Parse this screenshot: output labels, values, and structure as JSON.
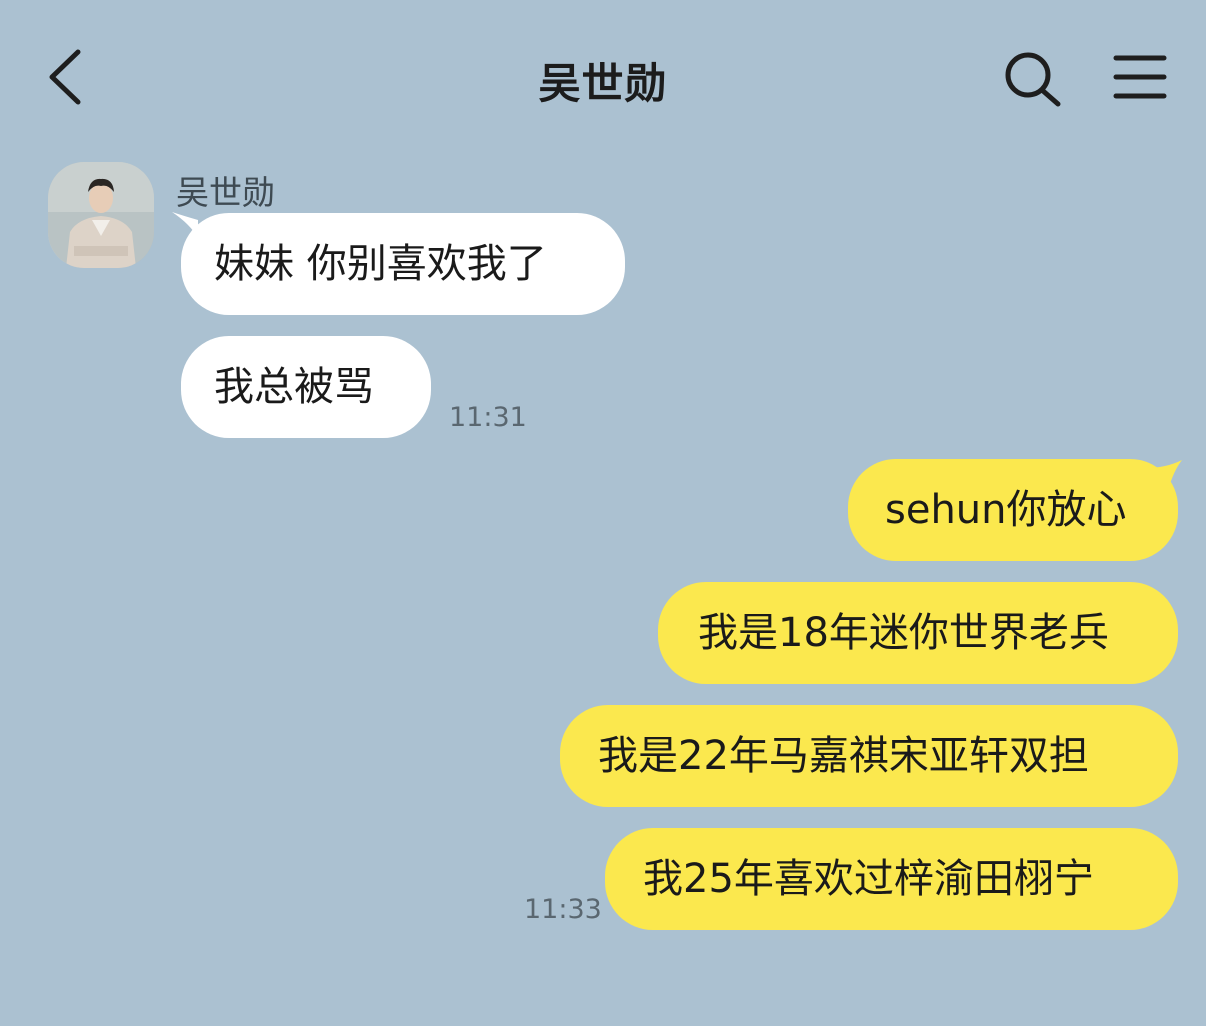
{
  "header": {
    "title": "吴世勋",
    "back_icon": "chevron-left-icon",
    "search_icon": "search-icon",
    "menu_icon": "hamburger-menu-icon"
  },
  "contact": {
    "name": "吴世勋",
    "avatar_icon": "avatar-photo"
  },
  "incoming": [
    {
      "text": "妹妹 你别喜欢我了"
    },
    {
      "text": "我总被骂"
    }
  ],
  "incoming_time": "11:31",
  "outgoing": [
    {
      "text": "sehun你放心"
    },
    {
      "text": "我是18年迷你世界老兵"
    },
    {
      "text": "我是22年马嘉祺宋亚轩双担"
    },
    {
      "text": "我25年喜欢过梓渝田栩宁"
    }
  ],
  "outgoing_time": "11:33",
  "colors": {
    "background": "#abc1d1",
    "incoming_bubble": "#ffffff",
    "outgoing_bubble": "#fbe84e"
  }
}
